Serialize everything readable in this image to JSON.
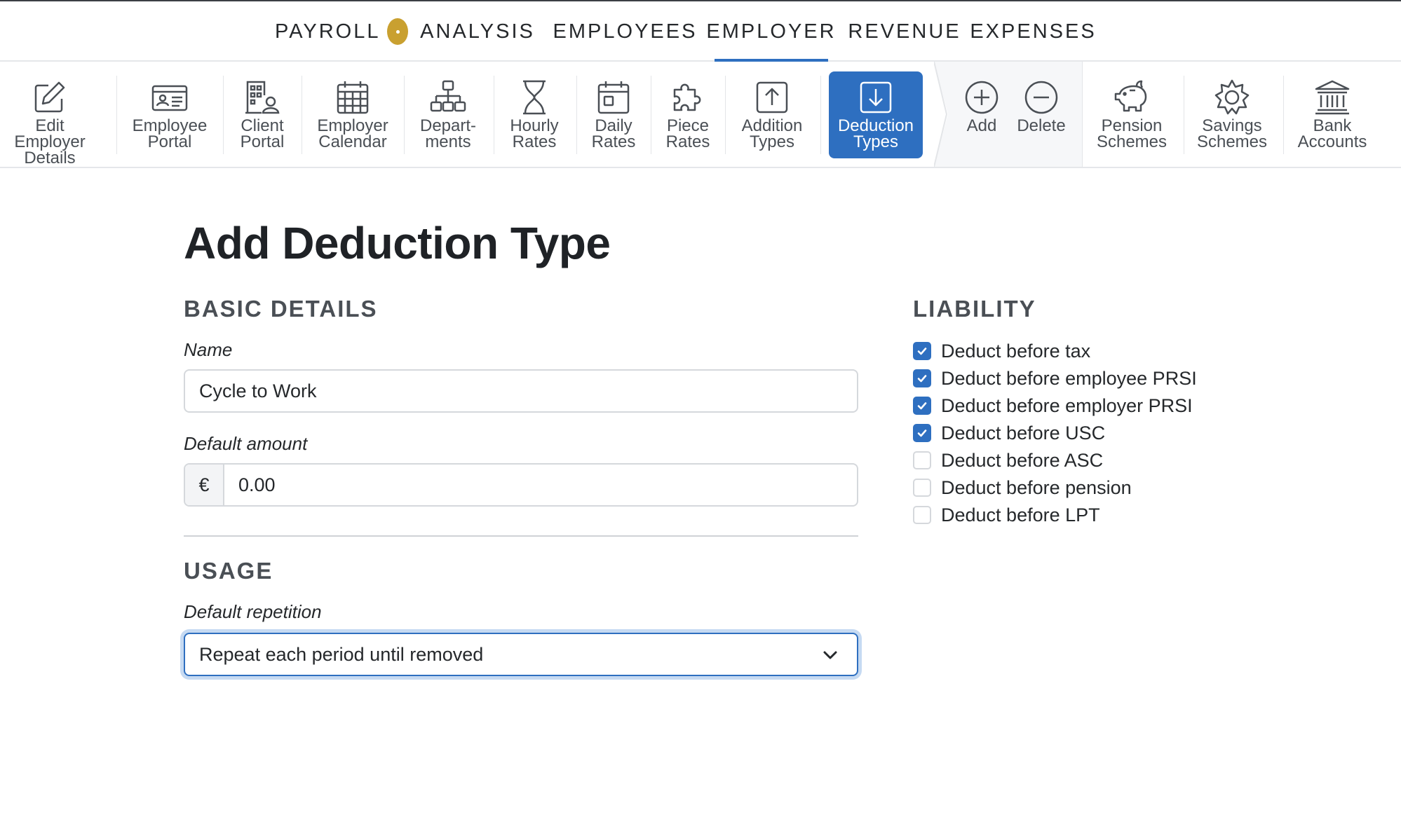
{
  "topnav": {
    "tabs": [
      {
        "label": "PAYROLL",
        "active": false
      },
      {
        "label": "ANALYSIS",
        "active": false
      },
      {
        "label": "EMPLOYEES",
        "active": false
      },
      {
        "label": "EMPLOYER",
        "active": true
      },
      {
        "label": "REVENUE",
        "active": false
      },
      {
        "label": "EXPENSES",
        "active": false
      }
    ]
  },
  "toolbar": {
    "items": [
      {
        "line1": "Edit Employer",
        "line2": "Details",
        "icon": "edit-icon"
      },
      {
        "line1": "Employee",
        "line2": "Portal",
        "icon": "id-card-icon"
      },
      {
        "line1": "Client",
        "line2": "Portal",
        "icon": "building-user-icon"
      },
      {
        "line1": "Employer",
        "line2": "Calendar",
        "icon": "calendar-grid-icon"
      },
      {
        "line1": "Depart-",
        "line2": "ments",
        "icon": "org-chart-icon"
      },
      {
        "line1": "Hourly",
        "line2": "Rates",
        "icon": "hourglass-icon"
      },
      {
        "line1": "Daily",
        "line2": "Rates",
        "icon": "calendar-day-icon"
      },
      {
        "line1": "Piece",
        "line2": "Rates",
        "icon": "puzzle-icon"
      },
      {
        "line1": "Addition",
        "line2": "Types",
        "icon": "upload-icon"
      },
      {
        "line1": "Deduction",
        "line2": "Types",
        "icon": "download-icon",
        "active": true
      },
      {
        "line1": "Add",
        "line2": "",
        "icon": "plus-circle-icon"
      },
      {
        "line1": "Delete",
        "line2": "",
        "icon": "minus-circle-icon"
      },
      {
        "line1": "Pension",
        "line2": "Schemes",
        "icon": "piggy-bank-icon"
      },
      {
        "line1": "Savings",
        "line2": "Schemes",
        "icon": "sun-icon"
      },
      {
        "line1": "Bank",
        "line2": "Accounts",
        "icon": "bank-icon"
      }
    ]
  },
  "page": {
    "title": "Add Deduction Type",
    "basic": {
      "heading": "BASIC DETAILS",
      "name_label": "Name",
      "name_value": "Cycle to Work",
      "amount_label": "Default amount",
      "currency": "€",
      "amount_value": "0.00"
    },
    "usage": {
      "heading": "USAGE",
      "repetition_label": "Default repetition",
      "repetition_value": "Repeat each period until removed"
    },
    "liability": {
      "heading": "LIABILITY",
      "options": [
        {
          "label": "Deduct before tax",
          "checked": true
        },
        {
          "label": "Deduct before employee PRSI",
          "checked": true
        },
        {
          "label": "Deduct before employer PRSI",
          "checked": true
        },
        {
          "label": "Deduct before USC",
          "checked": true
        },
        {
          "label": "Deduct before ASC",
          "checked": false
        },
        {
          "label": "Deduct before pension",
          "checked": false
        },
        {
          "label": "Deduct before LPT",
          "checked": false
        }
      ]
    }
  },
  "colors": {
    "accent": "#2e6fc0",
    "badge": "#c9a030",
    "text": "#25282b"
  }
}
